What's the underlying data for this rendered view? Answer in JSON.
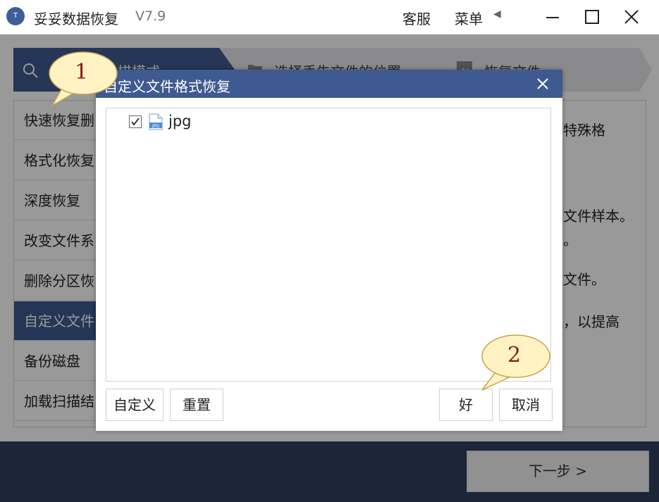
{
  "app": {
    "title": "妥妥数据恢复",
    "version": "V7.9",
    "logo_text": "T",
    "support": "客服",
    "menu": "菜单",
    "menu_arrow_icon": "triangle-left-icon"
  },
  "steps": [
    {
      "label": "描模式",
      "icon": "search-icon"
    },
    {
      "label": "选择丢失文件的位置",
      "icon": "folder-icon"
    },
    {
      "label": "恢复文件",
      "icon": "image-icon"
    }
  ],
  "sidebar": {
    "items": [
      {
        "label": "快速恢复删"
      },
      {
        "label": "格式化恢复"
      },
      {
        "label": "深度恢复"
      },
      {
        "label": "改变文件系"
      },
      {
        "label": "删除分区恢"
      },
      {
        "label": "自定义文件"
      },
      {
        "label": "备份磁盘"
      },
      {
        "label": "加载扫描结"
      }
    ],
    "active_index": 5
  },
  "description_fragments": [
    "特殊格",
    "文件样本。",
    "。",
    "文件。",
    "，以提高"
  ],
  "footer": {
    "next_label": "下一步 >"
  },
  "dialog": {
    "title": "自定义文件格式恢复",
    "items": [
      {
        "label": "jpg",
        "checked": true,
        "icon_text": "JPG"
      }
    ],
    "buttons": {
      "custom": "自定义",
      "reset": "重置",
      "ok": "好",
      "cancel": "取消"
    }
  },
  "callouts": [
    {
      "number": "1"
    },
    {
      "number": "2"
    }
  ],
  "colors": {
    "accent": "#3e5a90",
    "footer": "#2d3e5f",
    "callout_fill": "#fff3c4",
    "callout_text": "#8b1a1a"
  }
}
